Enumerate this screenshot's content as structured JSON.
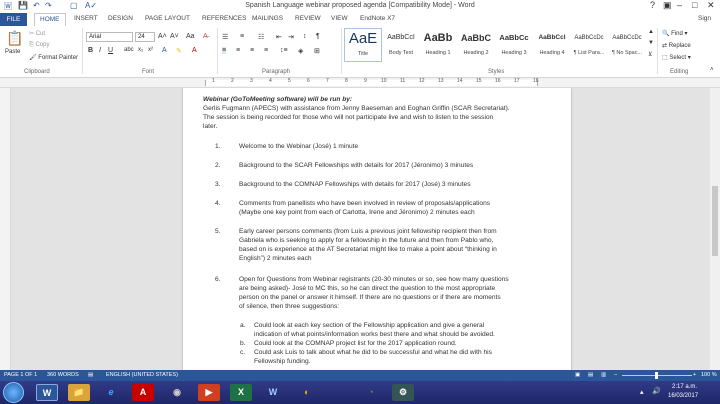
{
  "window": {
    "title": "Spanish Language webinar proposed agenda [Compatibility Mode] - Word",
    "controls": {
      "help": "?",
      "minimize": "–",
      "maximize": "□",
      "close": "✕"
    },
    "user": "Sign"
  },
  "ribbon_tabs": [
    "FILE",
    "HOME",
    "INSERT",
    "DESIGN",
    "PAGE LAYOUT",
    "REFERENCES",
    "MAILINGS",
    "REVIEW",
    "VIEW",
    "EndNote X7"
  ],
  "clipboard": {
    "paste": "Paste",
    "cut": "Cut",
    "copy": "Copy",
    "format_painter": "Format Painter",
    "group": "Clipboard"
  },
  "font": {
    "name": "Arial",
    "size": "24",
    "group": "Font"
  },
  "paragraph": {
    "group": "Paragraph"
  },
  "styles": {
    "group": "Styles",
    "items": [
      {
        "preview": "AaE",
        "name": "Title"
      },
      {
        "preview": "AaBbCcI",
        "name": "Body Text"
      },
      {
        "preview": "AaBb",
        "name": "Heading 1"
      },
      {
        "preview": "AaBbC",
        "name": "Heading 2"
      },
      {
        "preview": "AaBbCc",
        "name": "Heading 3"
      },
      {
        "preview": "AaBbCcI",
        "name": "Heading 4"
      },
      {
        "preview": "AaBbCcDc",
        "name": "¶ List Para..."
      },
      {
        "preview": "AaBbCcDc",
        "name": "¶ No Spac..."
      }
    ]
  },
  "editing": {
    "find": "Find",
    "replace": "Replace",
    "select": "Select",
    "group": "Editing"
  },
  "document": {
    "intro_bold": "Webinar (GoToMeeting software) will be run by:",
    "intro_line2": "Gerlis Fugmann (APECS) with assistance from Jenny Baeseman and Eoghan Griffin (SCAR Secretariat).",
    "intro_line3": "The session is being recorded for those who will not participate live and wish to listen to the session",
    "intro_line4": "later.",
    "items": [
      {
        "num": "1.",
        "lines": [
          "Welcome to the Webinar (José) 1 minute"
        ]
      },
      {
        "num": "2.",
        "lines": [
          "Background to the SCAR Fellowships with details for 2017 (Jéronimo) 3 minutes"
        ]
      },
      {
        "num": "3.",
        "lines": [
          "Background to the COMNAP Fellowships with details for 2017 (José) 3 minutes"
        ]
      },
      {
        "num": "4.",
        "lines": [
          "Comments from panellists who have been involved in review of proposals/applications",
          "(Maybe one key point from each of Carlotta, Irene and Jéronimo) 2 minutes each"
        ]
      },
      {
        "num": "5.",
        "lines": [
          "Early career persons comments (from Luis a previous joint fellowship recipient then from",
          "Gabriela who is seeking to apply for a fellowship in the future and then from Pablo who,",
          "based on is experience at the AT Secretariat might like to make a point about “thinking in",
          "English”) 2 minutes each"
        ]
      },
      {
        "num": "6.",
        "lines": [
          "Open for Questions from Webinar registrants (20-30 minutes or so, see how many questions",
          "are being asked)- José to MC this, so he can direct the question to the most appropriate",
          "person on the panel or answer it himself.  If there are no questions or if there are moments",
          "of silence, then three suggestions:"
        ]
      }
    ],
    "sub_items": [
      {
        "num": "a.",
        "lines": [
          "Could look at each key section of the Fellowship application and give a general",
          "indication of what points/information works best there and what should be avoided."
        ]
      },
      {
        "num": "b.",
        "lines": [
          "Could look at the COMNAP project list for the 2017 application round."
        ]
      },
      {
        "num": "c.",
        "lines": [
          "Could ask Luis to talk about what he did to be successful and what he did with his",
          "Fellowship funding."
        ]
      }
    ]
  },
  "ruler_numbers": [
    "1",
    "2",
    "3",
    "4",
    "5",
    "6",
    "7",
    "8",
    "9",
    "10",
    "11",
    "12",
    "13",
    "14",
    "15",
    "16",
    "17",
    "18"
  ],
  "status": {
    "page": "PAGE 1 OF 1",
    "words": "360 WORDS",
    "language": "ENGLISH (UNITED STATES)",
    "zoom": "100 %"
  },
  "taskbar": {
    "apps": [
      "W",
      "📁",
      "e",
      "A",
      "◉",
      "▶",
      "X",
      "W",
      "◐",
      "◔",
      "⚙"
    ],
    "time": "2:17 a.m.",
    "date": "16/03/2017"
  },
  "colors": {
    "accent": "#2b579a",
    "taskbar": "#262f78"
  }
}
